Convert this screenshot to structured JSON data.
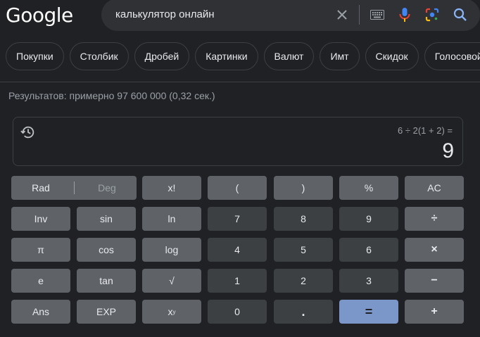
{
  "header": {
    "logo_text": "Google",
    "search_value": "калькулятор онлайн"
  },
  "icons": {
    "clear": "close-icon",
    "keyboard": "keyboard-icon",
    "voice": "microphone-icon",
    "lens": "lens-icon",
    "search": "search-icon",
    "history": "history-icon"
  },
  "chips": [
    "Покупки",
    "Столбик",
    "Дробей",
    "Картинки",
    "Валют",
    "Имт",
    "Скидок",
    "Голосовой"
  ],
  "results_stats": "Результатов: примерно 97 600 000 (0,32 сек.)",
  "calculator": {
    "expression": "6 ÷ 2(1 + 2) =",
    "result": "9",
    "keys": {
      "rad": "Rad",
      "deg": "Deg",
      "fact": "x!",
      "lparen": "(",
      "rparen": ")",
      "percent": "%",
      "ac": "AC",
      "inv": "Inv",
      "sin": "sin",
      "ln": "ln",
      "n7": "7",
      "n8": "8",
      "n9": "9",
      "divide": "÷",
      "pi": "π",
      "cos": "cos",
      "log": "log",
      "n4": "4",
      "n5": "5",
      "n6": "6",
      "multiply": "×",
      "e": "e",
      "tan": "tan",
      "sqrt": "√",
      "n1": "1",
      "n2": "2",
      "n3": "3",
      "minus": "−",
      "ans": "Ans",
      "exp": "EXP",
      "pow_base": "x",
      "pow_exp": "y",
      "n0": "0",
      "dot": ".",
      "equals": "=",
      "plus": "+"
    }
  },
  "colors": {
    "background": "#202124",
    "key_function": "#5f6368",
    "key_number": "#3c4043",
    "key_equals": "#7b96c8"
  }
}
